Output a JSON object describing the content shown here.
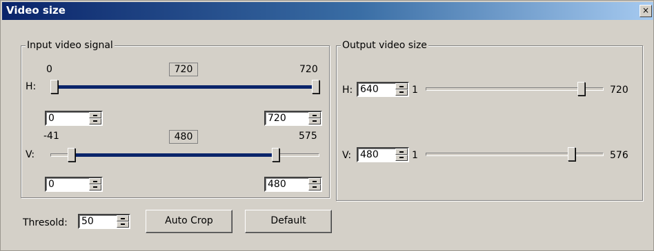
{
  "window": {
    "title": "Video size",
    "close_glyph": "×"
  },
  "input_group": {
    "title": "Input video signal",
    "h": {
      "label": "H:",
      "min_label": "0",
      "center_label": "720",
      "max_label": "720",
      "range_min": 0,
      "range_max": 720,
      "low_value": 0,
      "high_value": 720,
      "low_field": "0",
      "high_field": "720"
    },
    "v": {
      "label": "V:",
      "min_label": "-41",
      "center_label": "480",
      "max_label": "575",
      "range_min": -41,
      "range_max": 575,
      "low_value": 0,
      "high_value": 480,
      "low_field": "0",
      "high_field": "480"
    }
  },
  "output_group": {
    "title": "Output video size",
    "h": {
      "label": "H:",
      "value": "640",
      "min_label": "1",
      "max_label": "720",
      "range_min": 1,
      "range_max": 720,
      "slider_value": 640
    },
    "v": {
      "label": "V:",
      "value": "480",
      "min_label": "1",
      "max_label": "576",
      "range_min": 1,
      "range_max": 576,
      "slider_value": 480
    }
  },
  "bottom": {
    "threshold_label": "Thresold:",
    "threshold_value": "50",
    "auto_crop_label": "Auto Crop",
    "default_label": "Default"
  },
  "colors": {
    "title_gradient_start": "#0a246a",
    "title_gradient_end": "#a6caf0",
    "dialog_face": "#d4d0c8",
    "selection_fill": "#0a246a"
  }
}
